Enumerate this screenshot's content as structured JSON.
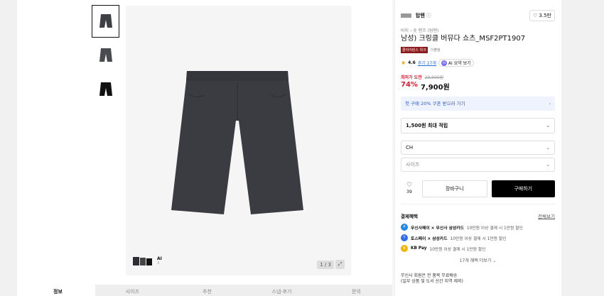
{
  "brand": {
    "name": "탑텐",
    "info_icon": "info-icon",
    "like_count": "3.5만"
  },
  "breadcrumb": "바지 › 숏 팬츠 (팀텐)",
  "title": "남성) 크링클 버뮤다 쇼츠_MSF2PT1907",
  "badges": {
    "red": "클리어런스 위크",
    "text": "이쁠템"
  },
  "rating": {
    "score": "4.6",
    "reviews": "후기 27개",
    "ai_chip": "AI 요약 보기"
  },
  "pricing": {
    "label": "최저가 도전",
    "original": "29,900원",
    "discount": "74%",
    "price": "7,900원"
  },
  "coupon": "첫 구매 20% 쿠폰 받으러 가기",
  "points": "1,500원 최대 적립",
  "options": {
    "color": "CH",
    "size": "사이즈"
  },
  "actions": {
    "like_count": "39",
    "cart": "장바구니",
    "buy": "구매하기"
  },
  "benefits": {
    "title": "결제혜택",
    "all": "전체보기",
    "items": [
      {
        "name": "무신사페이 × 무신사 삼성카드",
        "desc": "10만원 이상 결제 시 1만원 할인",
        "color": "#1e88e5"
      },
      {
        "name": "토스페이 × 삼성카드",
        "desc": "10만원 이상 결제 시 1만원 할인",
        "color": "#2f6de8"
      },
      {
        "name": "KB Pay",
        "desc": "10만원 이상 결제 시 1만원 할인",
        "color": "#f5b400"
      }
    ],
    "more": "17개 혜택 더보기"
  },
  "shipping": {
    "line1": "무신사 회원은 전 품목 무료배송",
    "line2": "(일부 상품 및 도서 산간 지역 제외)"
  },
  "gallery": {
    "pager": "1 / 3",
    "ai_label": "AI",
    "ai_sub": "3"
  },
  "tabs": [
    "정보",
    "사이즈",
    "추천",
    "스냅·후기",
    "문의"
  ]
}
